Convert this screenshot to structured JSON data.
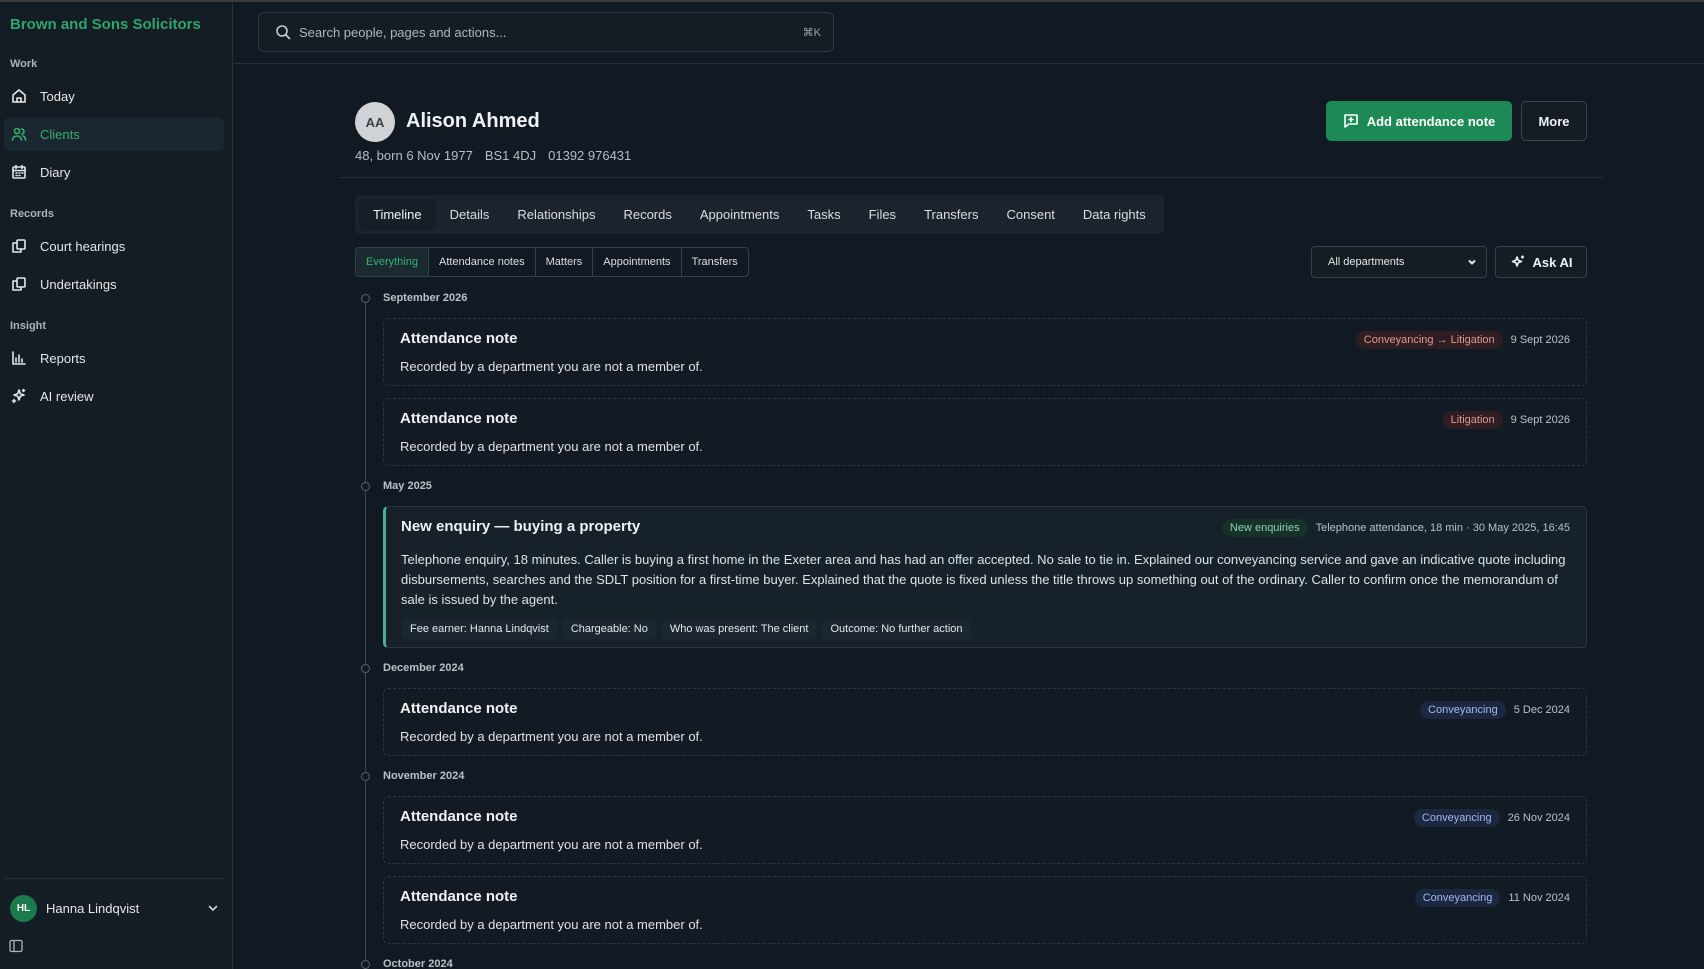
{
  "sidebar": {
    "brand": "Brown and Sons Solicitors",
    "sections": [
      {
        "label": "Work",
        "items": [
          {
            "label": "Today",
            "icon": "home-icon"
          },
          {
            "label": "Clients",
            "icon": "users-icon",
            "active": true
          },
          {
            "label": "Diary",
            "icon": "calendar-icon"
          }
        ]
      },
      {
        "label": "Records",
        "items": [
          {
            "label": "Court hearings",
            "icon": "copy-icon"
          },
          {
            "label": "Undertakings",
            "icon": "copy-icon"
          }
        ]
      },
      {
        "label": "Insight",
        "items": [
          {
            "label": "Reports",
            "icon": "bar-chart-icon"
          },
          {
            "label": "AI review",
            "icon": "sparkles-icon"
          }
        ]
      }
    ],
    "user": {
      "initials": "HL",
      "name": "Hanna Lindqvist"
    }
  },
  "search": {
    "placeholder": "Search people, pages and actions...",
    "shortcut": "⌘K"
  },
  "client": {
    "initials": "AA",
    "name": "Alison Ahmed",
    "meta": [
      "48, born 6 Nov 1977",
      "BS1 4DJ",
      "01392 976431"
    ]
  },
  "actions": {
    "add_note": "Add attendance note",
    "more": "More",
    "ask_ai": "Ask AI"
  },
  "tabs": [
    "Timeline",
    "Details",
    "Relationships",
    "Records",
    "Appointments",
    "Tasks",
    "Files",
    "Transfers",
    "Consent",
    "Data rights"
  ],
  "filters": [
    "Everything",
    "Attendance notes",
    "Matters",
    "Appointments",
    "Transfers"
  ],
  "department_select": {
    "selected": "All departments"
  },
  "timeline": {
    "months": [
      "September 2026",
      "May 2025",
      "December 2024",
      "November 2024",
      "October 2024"
    ],
    "entries": [
      {
        "title": "Attendance note",
        "body": "Recorded by a department you are not a member of.",
        "badge": "Conveyancing → Litigation",
        "date": "9 Sept 2026"
      },
      {
        "title": "Attendance note",
        "body": "Recorded by a department you are not a member of.",
        "badge": "Litigation",
        "date": "9 Sept 2026"
      },
      {
        "title": "New enquiry — buying a property",
        "body": "Telephone enquiry, 18 minutes. Caller is buying a first home in the Exeter area and has had an offer accepted. No sale to tie in. Explained our conveyancing service and gave an indicative quote including disbursements, searches and the SDLT position for a first-time buyer. Explained that the quote is fixed unless the title throws up something out of the ordinary. Caller to confirm once the memorandum of sale is issued by the agent.",
        "badge": "New enquiries",
        "date": "Telephone attendance, 18 min · 30 May 2025, 16:45",
        "chips": [
          "Fee earner: Hanna Lindqvist",
          "Chargeable: No",
          "Who was present: The client",
          "Outcome: No further action"
        ]
      },
      {
        "title": "Attendance note",
        "body": "Recorded by a department you are not a member of.",
        "badge": "Conveyancing",
        "date": "5 Dec 2024"
      },
      {
        "title": "Attendance note",
        "body": "Recorded by a department you are not a member of.",
        "badge": "Conveyancing",
        "date": "26 Nov 2024"
      },
      {
        "title": "Attendance note",
        "body": "Recorded by a department you are not a member of.",
        "badge": "Conveyancing",
        "date": "11 Nov 2024"
      }
    ]
  },
  "colors": {
    "accent": "#1d8a55",
    "brand": "#2fa46c",
    "background": "#111a22"
  }
}
